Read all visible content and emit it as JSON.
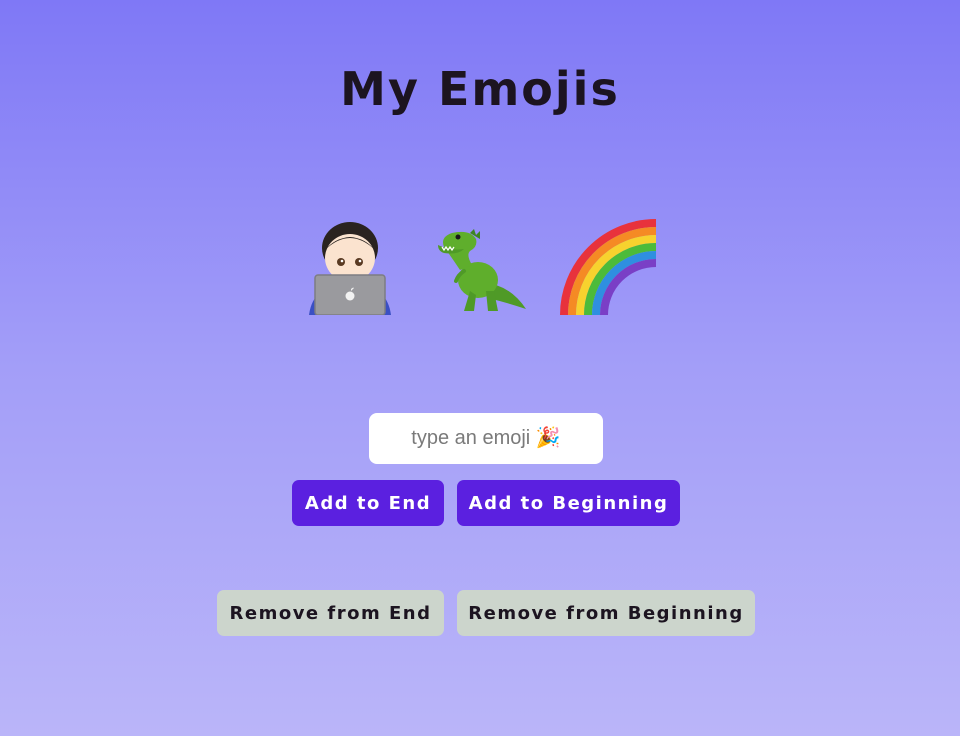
{
  "page": {
    "title": "My Emojis"
  },
  "emojis": [
    {
      "icon": "technologist-laptop-icon",
      "char": "🧑🏻‍💻"
    },
    {
      "icon": "t-rex-icon",
      "char": "🦖"
    },
    {
      "icon": "rainbow-icon",
      "char": "🌈"
    }
  ],
  "input": {
    "placeholder": "type an emoji 🎉",
    "value": ""
  },
  "buttons": {
    "add_end": "Add to End",
    "add_beginning": "Add to Beginning",
    "remove_end": "Remove from End",
    "remove_beginning": "Remove from Beginning"
  },
  "colors": {
    "background_top": "#7f78f6",
    "background_bottom": "#bab5f9",
    "primary_button": "#5b20e0",
    "secondary_button": "#ccd5cc",
    "title_text": "#1c1420"
  }
}
